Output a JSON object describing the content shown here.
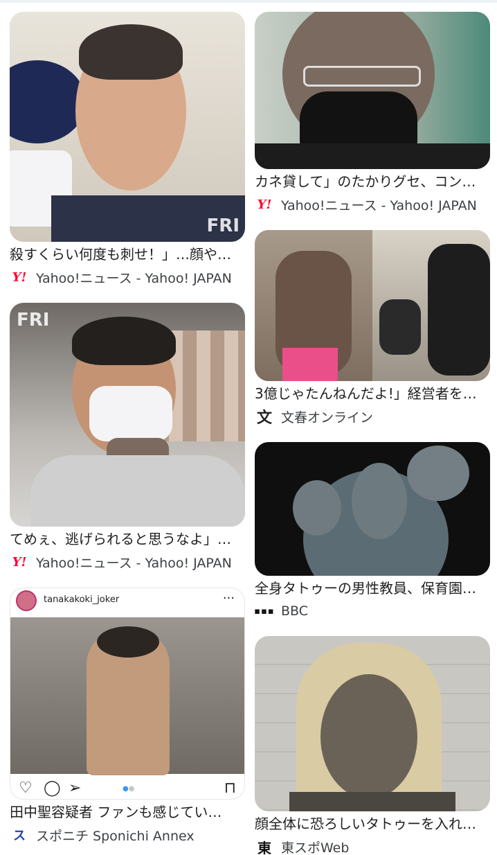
{
  "cards": [
    {
      "title": "殺すくらい何度も刺せ！」…顔や…",
      "source": "Yahoo!ニュース - Yahoo! JAPAN",
      "favicon": "yahoo-icon",
      "favicon_text": "Y!"
    },
    {
      "title": "カネ貸して」のたかりグセ、コン…",
      "source": "Yahoo!ニュース - Yahoo! JAPAN",
      "favicon": "yahoo-icon",
      "favicon_text": "Y!"
    },
    {
      "title": "3億じゃたんねんだよ!」経営者を…",
      "source": "文春オンライン",
      "favicon": "bunshun-icon",
      "favicon_text": "文"
    },
    {
      "title": "てめぇ、逃げられると思うなよ」…",
      "source": "Yahoo!ニュース - Yahoo! JAPAN",
      "favicon": "yahoo-icon",
      "favicon_text": "Y!"
    },
    {
      "title": "全身タトゥーの男性教員、保育園…",
      "source": "BBC",
      "favicon": "bbc-icon",
      "favicon_text": "▪▪▪"
    },
    {
      "title": "田中聖容疑者 ファンも感じてい…",
      "source": "スポニチ Sponichi Annex",
      "favicon": "sponichi-icon",
      "favicon_text": "ス"
    },
    {
      "title": "顔全体に恐ろしいタトゥーを入れ…",
      "source": "東スポWeb",
      "favicon": "tospo-icon",
      "favicon_text": "東"
    }
  ],
  "overlays": {
    "friday1": "FRI",
    "friday2": "FRI",
    "ig_username": "tanakakoki_joker",
    "ig_more": "···"
  },
  "colors": {
    "yahoo": "#ff0033",
    "title": "#1f1f1f",
    "source": "#3c4043"
  }
}
